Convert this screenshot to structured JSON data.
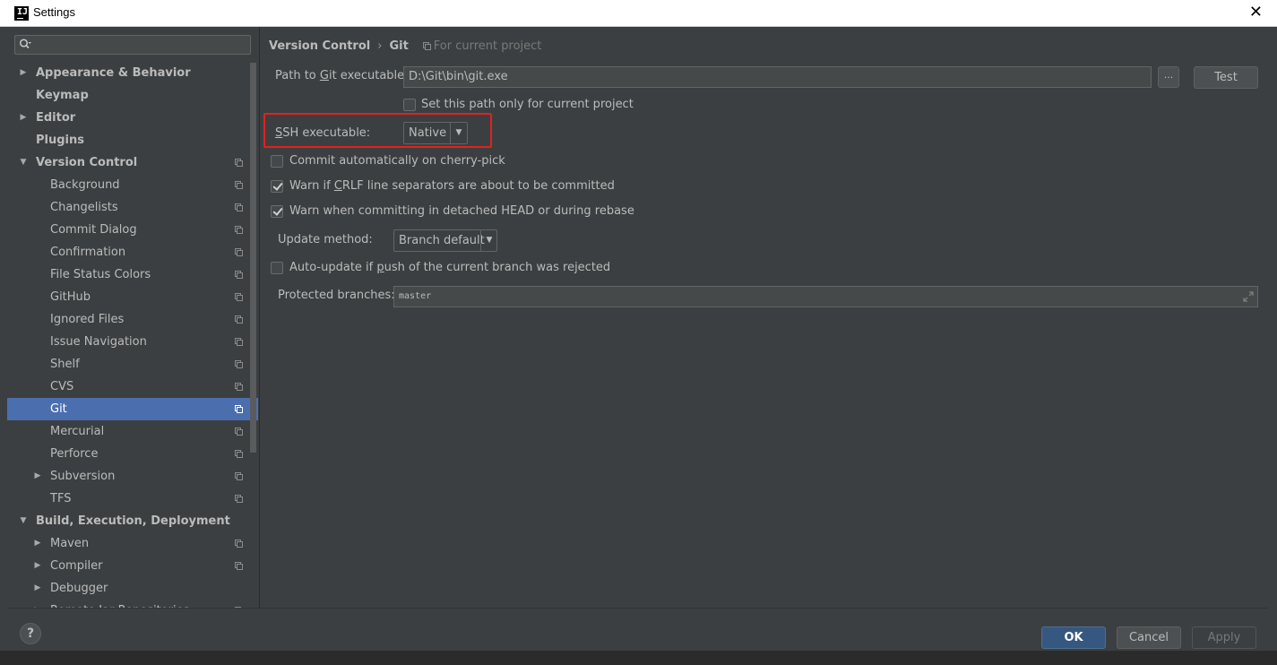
{
  "window": {
    "title": "Settings",
    "app_icon": "IJ"
  },
  "search": {
    "placeholder": ""
  },
  "sidebar": {
    "items": [
      {
        "label": "Appearance & Behavior",
        "bold": true,
        "expandable": true
      },
      {
        "label": "Keymap",
        "bold": true,
        "expandable": false
      },
      {
        "label": "Editor",
        "bold": true,
        "expandable": true
      },
      {
        "label": "Plugins",
        "bold": true,
        "expandable": false
      },
      {
        "label": "Version Control",
        "bold": true,
        "expanded": true
      },
      {
        "label": "Background"
      },
      {
        "label": "Changelists"
      },
      {
        "label": "Commit Dialog"
      },
      {
        "label": "Confirmation"
      },
      {
        "label": "File Status Colors"
      },
      {
        "label": "GitHub"
      },
      {
        "label": "Ignored Files"
      },
      {
        "label": "Issue Navigation"
      },
      {
        "label": "Shelf"
      },
      {
        "label": "CVS"
      },
      {
        "label": "Git",
        "selected": true
      },
      {
        "label": "Mercurial"
      },
      {
        "label": "Perforce"
      },
      {
        "label": "Subversion",
        "expandable": true
      },
      {
        "label": "TFS"
      },
      {
        "label": "Build, Execution, Deployment",
        "bold": true,
        "expanded": true
      },
      {
        "label": "Maven",
        "expandable": true
      },
      {
        "label": "Compiler",
        "expandable": true
      },
      {
        "label": "Debugger",
        "expandable": true
      },
      {
        "label": "Remote Jar Repositories"
      }
    ]
  },
  "breadcrumb": {
    "parent": "Version Control",
    "separator": "›",
    "current": "Git",
    "scope": "For current project"
  },
  "git": {
    "path_label_pre": "Path to ",
    "path_label_u": "G",
    "path_label_post": "it executable:",
    "path_value": "D:\\Git\\bin\\git.exe",
    "browse_label": "...",
    "test_label": "Test",
    "set_path_label": "Set this path only for current project",
    "set_path_checked": false,
    "ssh_label_u": "S",
    "ssh_label_post": "SH executable:",
    "ssh_value": "Native",
    "commit_cherry_label": "Commit automatically on cherry-pick",
    "commit_cherry_checked": false,
    "warn_crlf_pre": "Warn if ",
    "warn_crlf_u": "C",
    "warn_crlf_post": "RLF line separators are about to be committed",
    "warn_crlf_checked": true,
    "warn_detached_label": "Warn when committing in detached HEAD or during rebase",
    "warn_detached_checked": true,
    "update_method_label": "Update method:",
    "update_method_value": "Branch default",
    "auto_update_pre": "Auto-update if ",
    "auto_update_u": "p",
    "auto_update_post": "ush of the current branch was rejected",
    "auto_update_checked": false,
    "protected_label": "Protected branches:",
    "protected_value": "master"
  },
  "footer": {
    "help": "?",
    "ok": "OK",
    "cancel": "Cancel",
    "apply": "Apply"
  },
  "colors": {
    "accent": "#4b6eaf",
    "ok_button": "#365880",
    "highlight_box": "#e0221e",
    "background": "#3c3f41"
  }
}
